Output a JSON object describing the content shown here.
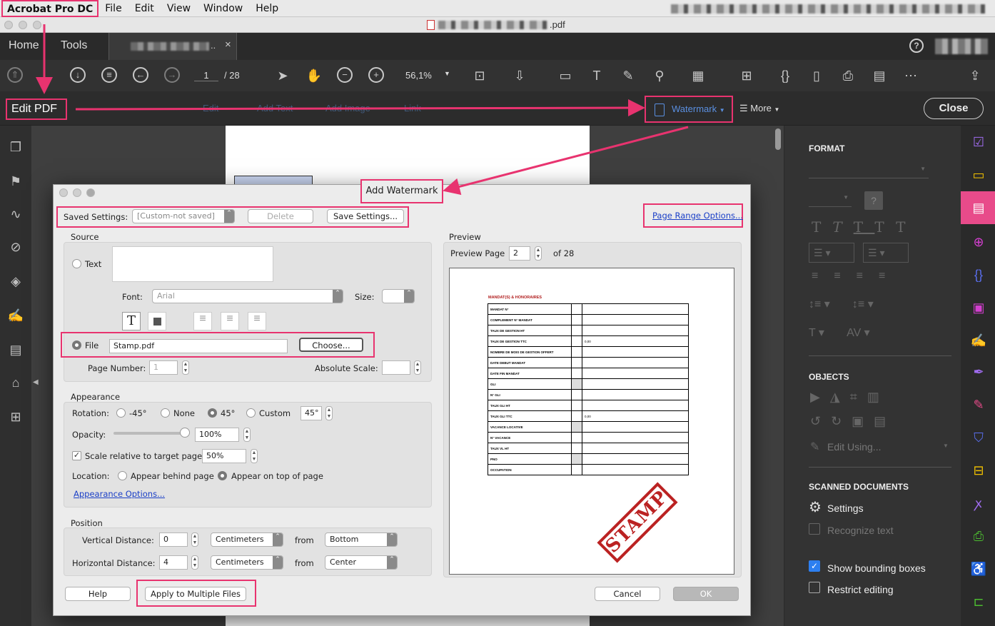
{
  "menubar": {
    "app": "Acrobat Pro DC",
    "items": [
      "File",
      "Edit",
      "View",
      "Window",
      "Help"
    ]
  },
  "window": {
    "title_suffix": ".pdf"
  },
  "tabs": {
    "home": "Home",
    "tools": "Tools",
    "doc_tab": "..",
    "close": "×"
  },
  "toolbar": {
    "page_current": "1",
    "page_total": "/ 28",
    "zoom": "56,1%"
  },
  "edit_bar": {
    "label": "Edit PDF",
    "faded_items": [
      "Edit",
      "Add Text",
      "Add Image",
      "Link"
    ],
    "watermark": "Watermark",
    "more": "More",
    "close": "Close"
  },
  "right_panel": {
    "format_header": "FORMAT",
    "objects_header": "OBJECTS",
    "edit_using": "Edit Using...",
    "scanned_header": "SCANNED DOCUMENTS",
    "settings": "Settings",
    "recognize_text": "Recognize text",
    "show_bounding_boxes": "Show bounding boxes",
    "restrict_editing": "Restrict editing"
  },
  "dialog": {
    "title": "Add Watermark",
    "saved_settings_label": "Saved Settings:",
    "saved_settings_value": "[Custom-not saved]",
    "delete": "Delete",
    "save_settings": "Save Settings...",
    "page_range_options": "Page Range Options...",
    "source": {
      "header": "Source",
      "text_label": "Text",
      "font_label": "Font:",
      "font_value": "Arial",
      "size_label": "Size:",
      "file_label": "File",
      "file_value": "Stamp.pdf",
      "choose": "Choose...",
      "page_number_label": "Page Number:",
      "page_number_value": "1",
      "absolute_scale_label": "Absolute Scale:"
    },
    "appearance": {
      "header": "Appearance",
      "rotation_label": "Rotation:",
      "rot_m45": "-45°",
      "rot_none": "None",
      "rot_45": "45°",
      "rot_custom": "Custom",
      "custom_value": "45°",
      "opacity_label": "Opacity:",
      "opacity_value": "100%",
      "opacity_fraction": 1.0,
      "scale_label": "Scale relative to target page",
      "scale_value": "50%",
      "location_label": "Location:",
      "behind": "Appear behind page",
      "on_top": "Appear on top of page",
      "options_link": "Appearance Options..."
    },
    "position": {
      "header": "Position",
      "vertical_label": "Vertical Distance:",
      "vertical_value": "0",
      "vertical_unit": "Centimeters",
      "vertical_from_label": "from",
      "vertical_from": "Bottom",
      "horizontal_label": "Horizontal Distance:",
      "horizontal_value": "4",
      "horizontal_unit": "Centimeters",
      "horizontal_from_label": "from",
      "horizontal_from": "Center"
    },
    "preview": {
      "header": "Preview",
      "page_label": "Preview Page",
      "page_value": "2",
      "of_label": "of 28"
    },
    "help": "Help",
    "apply_multiple": "Apply to Multiple Files",
    "cancel": "Cancel",
    "ok": "OK"
  },
  "preview_doc": {
    "heading": "MANDAT(S) & HONORAIRES",
    "rows": [
      {
        "label": "MANDAT N°",
        "value": ""
      },
      {
        "label": "COMPLEMENT N° MANDAT",
        "value": ""
      },
      {
        "label": "TAUX DE GESTION HT",
        "value": ""
      },
      {
        "label": "TAUX DE GESTION TTC",
        "value": "0,00"
      },
      {
        "label": "NOMBRE DE MOIS DE GESTION OFFERT",
        "value": ""
      },
      {
        "label": "DATE DEBUT MANDAT",
        "value": ""
      },
      {
        "label": "DATE FIN MANDAT",
        "value": ""
      },
      {
        "label": "GLI",
        "value": ""
      },
      {
        "label": "N° GLI",
        "value": ""
      },
      {
        "label": "TAUX GLI HT",
        "value": ""
      },
      {
        "label": "TAUX GLI TTC",
        "value": "0,00"
      },
      {
        "label": "VACANCE LOCATIVE",
        "value": ""
      },
      {
        "label": "N° VACANCE",
        "value": ""
      },
      {
        "label": "TAUX VL HT",
        "value": ""
      },
      {
        "label": "PNO",
        "value": ""
      },
      {
        "label": "OCCUPATION",
        "value": ""
      }
    ],
    "stamp": "STAMP"
  },
  "colors": {
    "highlight": "#e8336f",
    "link": "#1a3fc7",
    "stamp": "#b22222"
  }
}
